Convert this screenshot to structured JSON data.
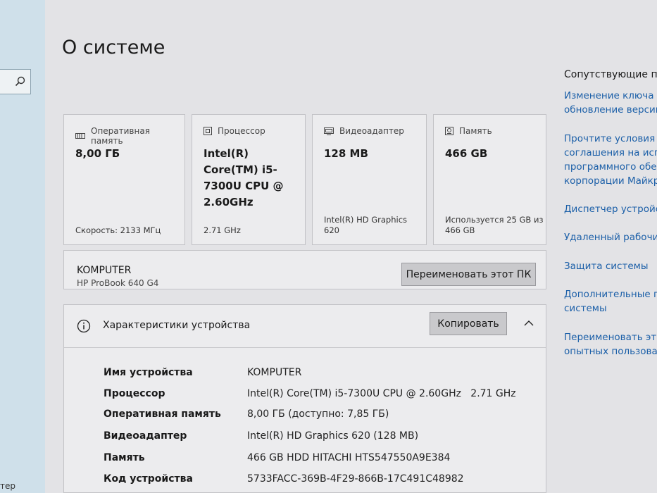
{
  "left": {
    "bottom_text": "тер"
  },
  "page_title": "О системе",
  "cards": [
    {
      "icon": "memory-icon",
      "label": "Оперативная память",
      "value": "8,00 ГБ",
      "sub": "Скорость: 2133 МГц"
    },
    {
      "icon": "cpu-icon",
      "label": "Процессор",
      "value": "Intel(R) Core(TM) i5-7300U CPU @ 2.60GHz",
      "sub": "2.71 GHz"
    },
    {
      "icon": "gpu-icon",
      "label": "Видеоадаптер",
      "value": "128 MB",
      "sub": "Intel(R) HD Graphics 620"
    },
    {
      "icon": "storage-icon",
      "label": "Память",
      "value": "466 GB",
      "sub": "Используется 25 GB из 466 GB"
    }
  ],
  "pc": {
    "name": "KOMPUTER",
    "model": "HP ProBook 640 G4",
    "rename_button": "Переименовать этот ПК"
  },
  "specs": {
    "title": "Характеристики устройства",
    "copy_button": "Копировать",
    "rows": [
      {
        "key": "Имя устройства",
        "value": "KOMPUTER"
      },
      {
        "key": "Процессор",
        "value": "Intel(R) Core(TM) i5-7300U CPU @ 2.60GHz   2.71 GHz"
      },
      {
        "key": "Оперативная память",
        "value": "8,00 ГБ (доступно: 7,85 ГБ)"
      },
      {
        "key": "Видеоадаптер",
        "value": "Intel(R) HD Graphics 620 (128 MB)"
      },
      {
        "key": "Память",
        "value": "466 GB HDD HITACHI HTS547550A9E384"
      },
      {
        "key": "Код устройства",
        "value": "5733FACC-369B-4F29-866B-17C491C48982"
      }
    ]
  },
  "right": {
    "title": "Сопутствующие пар",
    "links": [
      "Изменение ключа п",
      "обновление версии",
      "Прочтите условия л",
      "соглашения на исп",
      "программного обес",
      "корпорации Майкр",
      "Диспетчер устройс",
      "Удаленный рабочи",
      "Защита системы",
      "Дополнительные па",
      "системы",
      "Переименовать это",
      "опытных пользоват"
    ]
  },
  "colors": {
    "link": "#1b5fa8",
    "accent_strip": "#cfe0ea"
  }
}
